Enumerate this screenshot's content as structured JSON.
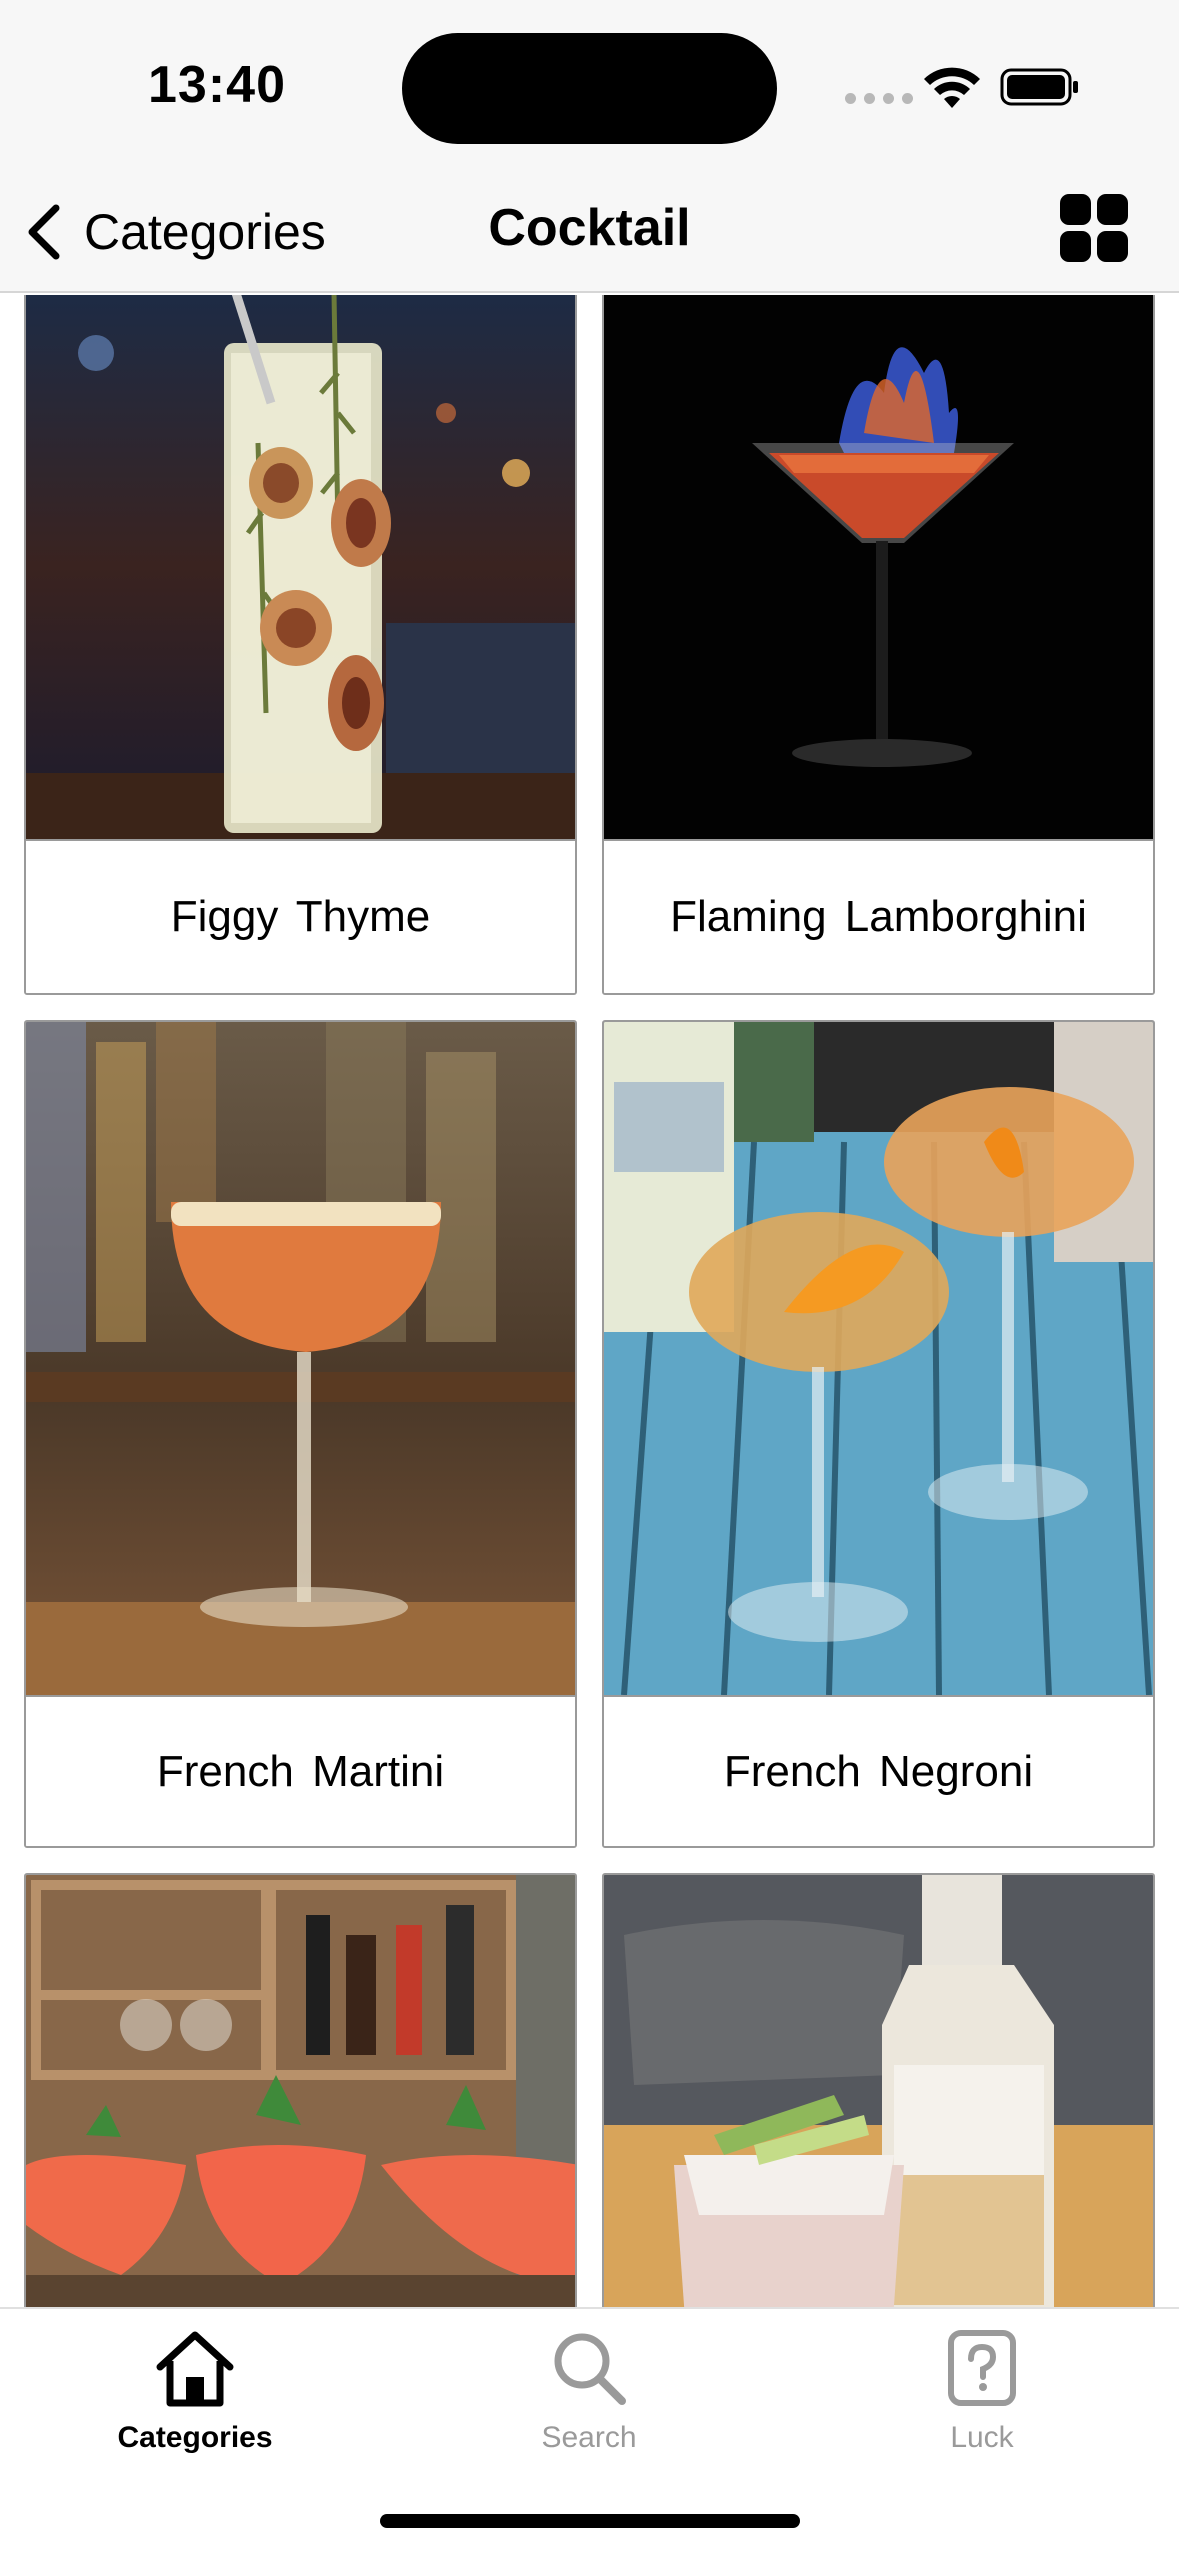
{
  "status_bar": {
    "time": "13:40"
  },
  "nav": {
    "back_label": "Categories",
    "title": "Cocktail"
  },
  "cards": [
    {
      "name": "Figgy Thyme"
    },
    {
      "name": "Flaming Lamborghini"
    },
    {
      "name": "French Martini"
    },
    {
      "name": "French Negroni"
    },
    {
      "name": ""
    },
    {
      "name": ""
    }
  ],
  "tabs": [
    {
      "label": "Categories",
      "icon": "house-icon",
      "active": true
    },
    {
      "label": "Search",
      "icon": "magnifier-icon",
      "active": false
    },
    {
      "label": "Luck",
      "icon": "question-square-icon",
      "active": false
    }
  ],
  "colors": {
    "bar_bg": "#f7f7f7",
    "inactive": "#9a9a9a",
    "active": "#000000"
  }
}
